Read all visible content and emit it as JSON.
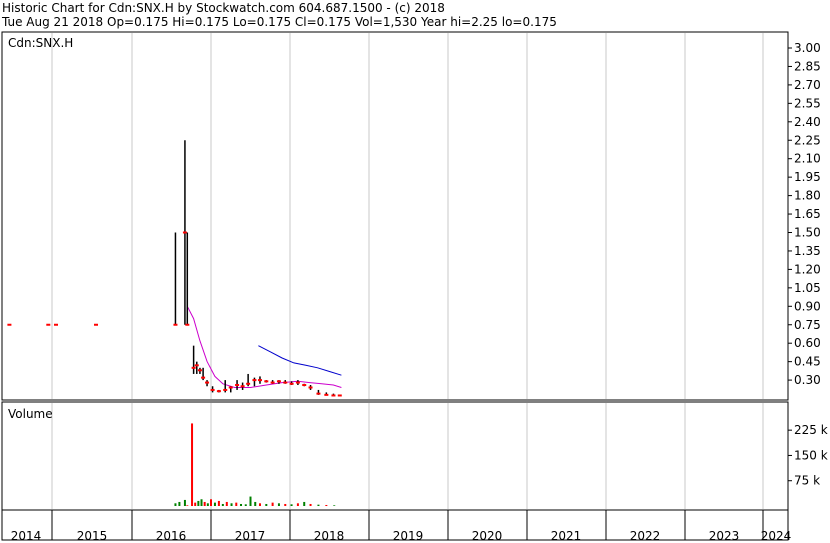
{
  "header": {
    "title_line": "Historic Chart for Cdn:SNX.H by Stockwatch.com 604.687.1500 - (c) 2018",
    "quote_line": "Tue Aug 21 2018  Op=0.175  Hi=0.175  Lo=0.175  Cl=0.175  Vol=1,530  Year hi=2.25  lo=0.175"
  },
  "chart_data": {
    "type": "bar",
    "symbol_label": "Cdn:SNX.H",
    "volume_label": "Volume",
    "x_years": [
      "2014",
      "2015",
      "2016",
      "2017",
      "2018",
      "2019",
      "2020",
      "2021",
      "2022",
      "2023",
      "2024"
    ],
    "price_axis": {
      "ticks": [
        "3.00",
        "2.85",
        "2.70",
        "2.55",
        "2.40",
        "2.25",
        "2.10",
        "1.95",
        "1.80",
        "1.65",
        "1.50",
        "1.35",
        "1.20",
        "1.05",
        "0.90",
        "0.75",
        "0.60",
        "0.45",
        "0.30"
      ],
      "range": [
        0.15,
        3.0
      ]
    },
    "volume_axis": {
      "ticks": [
        "225 k",
        "150 k",
        "75 k"
      ],
      "range": [
        0,
        270000
      ]
    },
    "grid": true,
    "colors": {
      "grid": "#c8c8c8",
      "up": "#008000",
      "down": "#ff0000",
      "ma_short": "#cc00cc",
      "ma_long": "#0000cc",
      "price": "#000000"
    },
    "price_bars": [
      {
        "date": "2013.85",
        "high": 0.75,
        "low": 0.75,
        "close": 0.75
      },
      {
        "date": "2014.90",
        "high": 0.75,
        "low": 0.75,
        "close": 0.75
      },
      {
        "date": "2015.05",
        "high": 0.75,
        "low": 0.75,
        "close": 0.75
      },
      {
        "date": "2015.55",
        "high": 0.75,
        "low": 0.75,
        "close": 0.75
      },
      {
        "date": "2016.55",
        "high": 1.5,
        "low": 0.75,
        "close": 0.75
      },
      {
        "date": "2016.67",
        "high": 2.25,
        "low": 0.75,
        "close": 1.5
      },
      {
        "date": "2016.70",
        "high": 1.5,
        "low": 0.75,
        "close": 0.75
      },
      {
        "date": "2016.78",
        "high": 0.58,
        "low": 0.35,
        "close": 0.4
      },
      {
        "date": "2016.82",
        "high": 0.45,
        "low": 0.35,
        "close": 0.42
      },
      {
        "date": "2016.86",
        "high": 0.4,
        "low": 0.35,
        "close": 0.38
      },
      {
        "date": "2016.90",
        "high": 0.4,
        "low": 0.3,
        "close": 0.32
      },
      {
        "date": "2016.95",
        "high": 0.3,
        "low": 0.25,
        "close": 0.28
      },
      {
        "date": "2017.02",
        "high": 0.25,
        "low": 0.2,
        "close": 0.22
      },
      {
        "date": "2017.10",
        "high": 0.22,
        "low": 0.2,
        "close": 0.21
      },
      {
        "date": "2017.18",
        "high": 0.3,
        "low": 0.2,
        "close": 0.22
      },
      {
        "date": "2017.25",
        "high": 0.25,
        "low": 0.2,
        "close": 0.24
      },
      {
        "date": "2017.33",
        "high": 0.3,
        "low": 0.22,
        "close": 0.26
      },
      {
        "date": "2017.40",
        "high": 0.28,
        "low": 0.22,
        "close": 0.25
      },
      {
        "date": "2017.47",
        "high": 0.35,
        "low": 0.25,
        "close": 0.27
      },
      {
        "date": "2017.55",
        "high": 0.32,
        "low": 0.25,
        "close": 0.3
      },
      {
        "date": "2017.62",
        "high": 0.33,
        "low": 0.27,
        "close": 0.3
      },
      {
        "date": "2017.70",
        "high": 0.3,
        "low": 0.28,
        "close": 0.29
      },
      {
        "date": "2017.78",
        "high": 0.3,
        "low": 0.27,
        "close": 0.28
      },
      {
        "date": "2017.86",
        "high": 0.3,
        "low": 0.27,
        "close": 0.29
      },
      {
        "date": "2017.94",
        "high": 0.3,
        "low": 0.27,
        "close": 0.28
      },
      {
        "date": "2018.02",
        "high": 0.29,
        "low": 0.26,
        "close": 0.27
      },
      {
        "date": "2018.10",
        "high": 0.3,
        "low": 0.26,
        "close": 0.28
      },
      {
        "date": "2018.18",
        "high": 0.27,
        "low": 0.25,
        "close": 0.26
      },
      {
        "date": "2018.26",
        "high": 0.26,
        "low": 0.22,
        "close": 0.24
      },
      {
        "date": "2018.36",
        "high": 0.22,
        "low": 0.18,
        "close": 0.19
      },
      {
        "date": "2018.46",
        "high": 0.2,
        "low": 0.175,
        "close": 0.18
      },
      {
        "date": "2018.55",
        "high": 0.19,
        "low": 0.175,
        "close": 0.175
      },
      {
        "date": "2018.63",
        "high": 0.175,
        "low": 0.175,
        "close": 0.175
      }
    ],
    "ma_short": [
      {
        "date": "2016.70",
        "value": 0.9
      },
      {
        "date": "2016.78",
        "value": 0.8
      },
      {
        "date": "2016.86",
        "value": 0.62
      },
      {
        "date": "2016.95",
        "value": 0.45
      },
      {
        "date": "2017.05",
        "value": 0.33
      },
      {
        "date": "2017.15",
        "value": 0.27
      },
      {
        "date": "2017.30",
        "value": 0.24
      },
      {
        "date": "2017.50",
        "value": 0.24
      },
      {
        "date": "2017.70",
        "value": 0.26
      },
      {
        "date": "2017.90",
        "value": 0.28
      },
      {
        "date": "2018.10",
        "value": 0.29
      },
      {
        "date": "2018.25",
        "value": 0.28
      },
      {
        "date": "2018.40",
        "value": 0.27
      },
      {
        "date": "2018.55",
        "value": 0.26
      },
      {
        "date": "2018.65",
        "value": 0.24
      }
    ],
    "ma_long": [
      {
        "date": "2017.60",
        "value": 0.58
      },
      {
        "date": "2017.75",
        "value": 0.53
      },
      {
        "date": "2017.90",
        "value": 0.48
      },
      {
        "date": "2018.05",
        "value": 0.44
      },
      {
        "date": "2018.20",
        "value": 0.42
      },
      {
        "date": "2018.35",
        "value": 0.4
      },
      {
        "date": "2018.50",
        "value": 0.37
      },
      {
        "date": "2018.65",
        "value": 0.34
      }
    ],
    "volume_bars": [
      {
        "date": "2016.55",
        "volume": 8000,
        "up": true
      },
      {
        "date": "2016.60",
        "volume": 12000,
        "up": true
      },
      {
        "date": "2016.67",
        "volume": 18000,
        "up": true
      },
      {
        "date": "2016.70",
        "volume": 2000,
        "up": false
      },
      {
        "date": "2016.76",
        "volume": 245000,
        "up": false
      },
      {
        "date": "2016.80",
        "volume": 10000,
        "up": false
      },
      {
        "date": "2016.84",
        "volume": 15000,
        "up": true
      },
      {
        "date": "2016.88",
        "volume": 20000,
        "up": true
      },
      {
        "date": "2016.92",
        "volume": 12000,
        "up": false
      },
      {
        "date": "2016.96",
        "volume": 8000,
        "up": true
      },
      {
        "date": "2017.00",
        "volume": 20000,
        "up": false
      },
      {
        "date": "2017.05",
        "volume": 10000,
        "up": true
      },
      {
        "date": "2017.10",
        "volume": 15000,
        "up": false
      },
      {
        "date": "2017.15",
        "volume": 6000,
        "up": true
      },
      {
        "date": "2017.20",
        "volume": 12000,
        "up": false
      },
      {
        "date": "2017.26",
        "volume": 8000,
        "up": true
      },
      {
        "date": "2017.32",
        "volume": 10000,
        "up": false
      },
      {
        "date": "2017.38",
        "volume": 6000,
        "up": true
      },
      {
        "date": "2017.44",
        "volume": 5000,
        "up": true
      },
      {
        "date": "2017.50",
        "volume": 28000,
        "up": true
      },
      {
        "date": "2017.56",
        "volume": 12000,
        "up": true
      },
      {
        "date": "2017.62",
        "volume": 8000,
        "up": false
      },
      {
        "date": "2017.70",
        "volume": 6000,
        "up": true
      },
      {
        "date": "2017.78",
        "volume": 10000,
        "up": false
      },
      {
        "date": "2017.86",
        "volume": 8000,
        "up": true
      },
      {
        "date": "2017.94",
        "volume": 6000,
        "up": false
      },
      {
        "date": "2018.02",
        "volume": 5000,
        "up": true
      },
      {
        "date": "2018.10",
        "volume": 8000,
        "up": false
      },
      {
        "date": "2018.18",
        "volume": 12000,
        "up": true
      },
      {
        "date": "2018.26",
        "volume": 6000,
        "up": false
      },
      {
        "date": "2018.36",
        "volume": 4000,
        "up": true
      },
      {
        "date": "2018.46",
        "volume": 3000,
        "up": false
      },
      {
        "date": "2018.56",
        "volume": 2000,
        "up": true
      }
    ]
  }
}
